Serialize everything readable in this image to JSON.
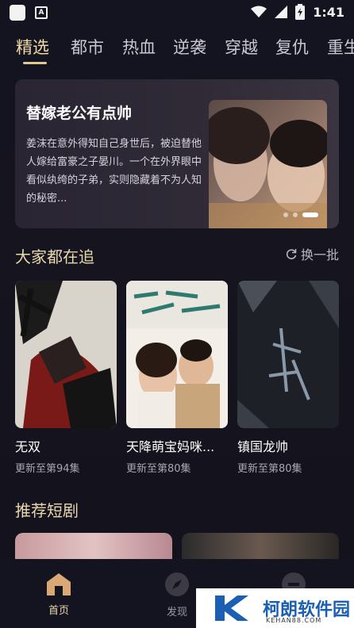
{
  "status_bar": {
    "time": "1:41",
    "app_icon_letter": "A"
  },
  "tabs": [
    {
      "label": "精选",
      "active": true
    },
    {
      "label": "都市"
    },
    {
      "label": "热血"
    },
    {
      "label": "逆袭"
    },
    {
      "label": "穿越"
    },
    {
      "label": "复仇"
    },
    {
      "label": "重生"
    }
  ],
  "banner": {
    "title": "替嫁老公有点帅",
    "description": "姜沫在意外得知自己身世后，被迫替他人嫁给富豪之子晏川。一个在外界眼中看似纨绔的子弟，实则隐藏着不为人知的秘密..."
  },
  "section_following": {
    "title": "大家都在追",
    "refresh_label": "换一批",
    "items": [
      {
        "title": "无双",
        "episodes": "更新至第94集"
      },
      {
        "title": "天降萌宝妈咪...",
        "episodes": "更新至第80集"
      },
      {
        "title": "镇国龙帅",
        "episodes": "更新至第80集"
      }
    ]
  },
  "section_recommend": {
    "title": "推荐短剧"
  },
  "bottom_nav": [
    {
      "label": "首页",
      "active": true
    },
    {
      "label": "发现"
    }
  ],
  "watermark": {
    "text": "柯朗软件园",
    "sub": "KEHAN88.COM"
  },
  "colors": {
    "accent": "#e9d7ad",
    "background": "#141420"
  }
}
